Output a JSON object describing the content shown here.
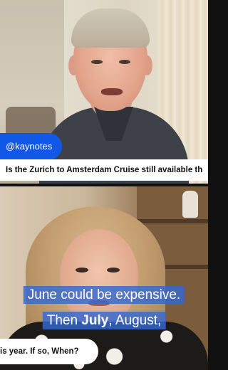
{
  "handle": "@kaynotes",
  "question_line_top": "Is the Zurich to Amsterdam Cruise still available th",
  "question_line_bottom": "is year. If so, When?",
  "captions": {
    "line1": "June could be expensive.",
    "line2_pre": "Then ",
    "line2_em": "July",
    "line2_post": ", August,"
  },
  "colors": {
    "handle_badge": "#1258e6",
    "caption_bg": "#3468d2",
    "question_bg": "#ffffff"
  }
}
